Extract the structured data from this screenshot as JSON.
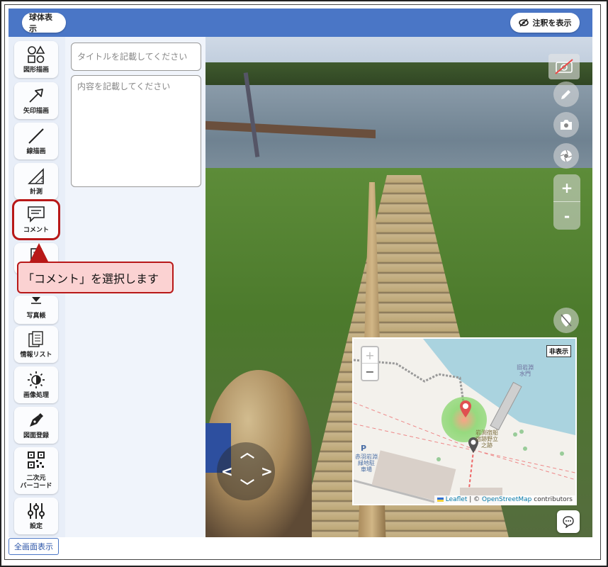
{
  "header": {
    "sphere_label": "球体表示",
    "annotation_label": "注釈を表示"
  },
  "sidebar": {
    "items": [
      {
        "label": "図形描画",
        "icon": "shapes-icon"
      },
      {
        "label": "矢印描画",
        "icon": "arrow-icon"
      },
      {
        "label": "線描画",
        "icon": "line-icon"
      },
      {
        "label": "計測",
        "icon": "ruler-triangle-icon"
      },
      {
        "label": "コメント",
        "icon": "comment-icon"
      },
      {
        "label": "写真帳",
        "icon": "photo-album-icon"
      },
      {
        "label": "情報リスト",
        "icon": "info-list-icon"
      },
      {
        "label": "画像処理",
        "icon": "brightness-icon"
      },
      {
        "label": "図面登録",
        "icon": "pen-nib-icon"
      },
      {
        "label": "二次元\nバーコード",
        "icon": "qr-code-icon"
      },
      {
        "label": "設定",
        "icon": "sliders-icon"
      }
    ]
  },
  "comment_panel": {
    "title_placeholder": "タイトルを記載してください",
    "body_placeholder": "内容を記載してください"
  },
  "callout": {
    "text": "「コメント」を選択します"
  },
  "map": {
    "hide_label": "非表示",
    "zoom_in": "+",
    "zoom_out": "−",
    "attribution_leaflet": "Leaflet",
    "attribution_sep": " | © ",
    "attribution_osm": "OpenStreetMap",
    "attribution_suffix": " contributors",
    "labels": {
      "top_right": "旧岩淵\n水門",
      "site": "岩渕宿船\n宿跡野立\n之跡",
      "station": "赤羽岩淵\n緑地駐\n車場",
      "p": "P"
    }
  },
  "viewer": {
    "zoom_in": "+",
    "zoom_out": "-"
  },
  "footer": {
    "fullscreen_label": "全画面表示"
  },
  "colors": {
    "header_blue": "#4a76c6",
    "highlight_red": "#b81818",
    "callout_bg": "#fbd2d2"
  }
}
